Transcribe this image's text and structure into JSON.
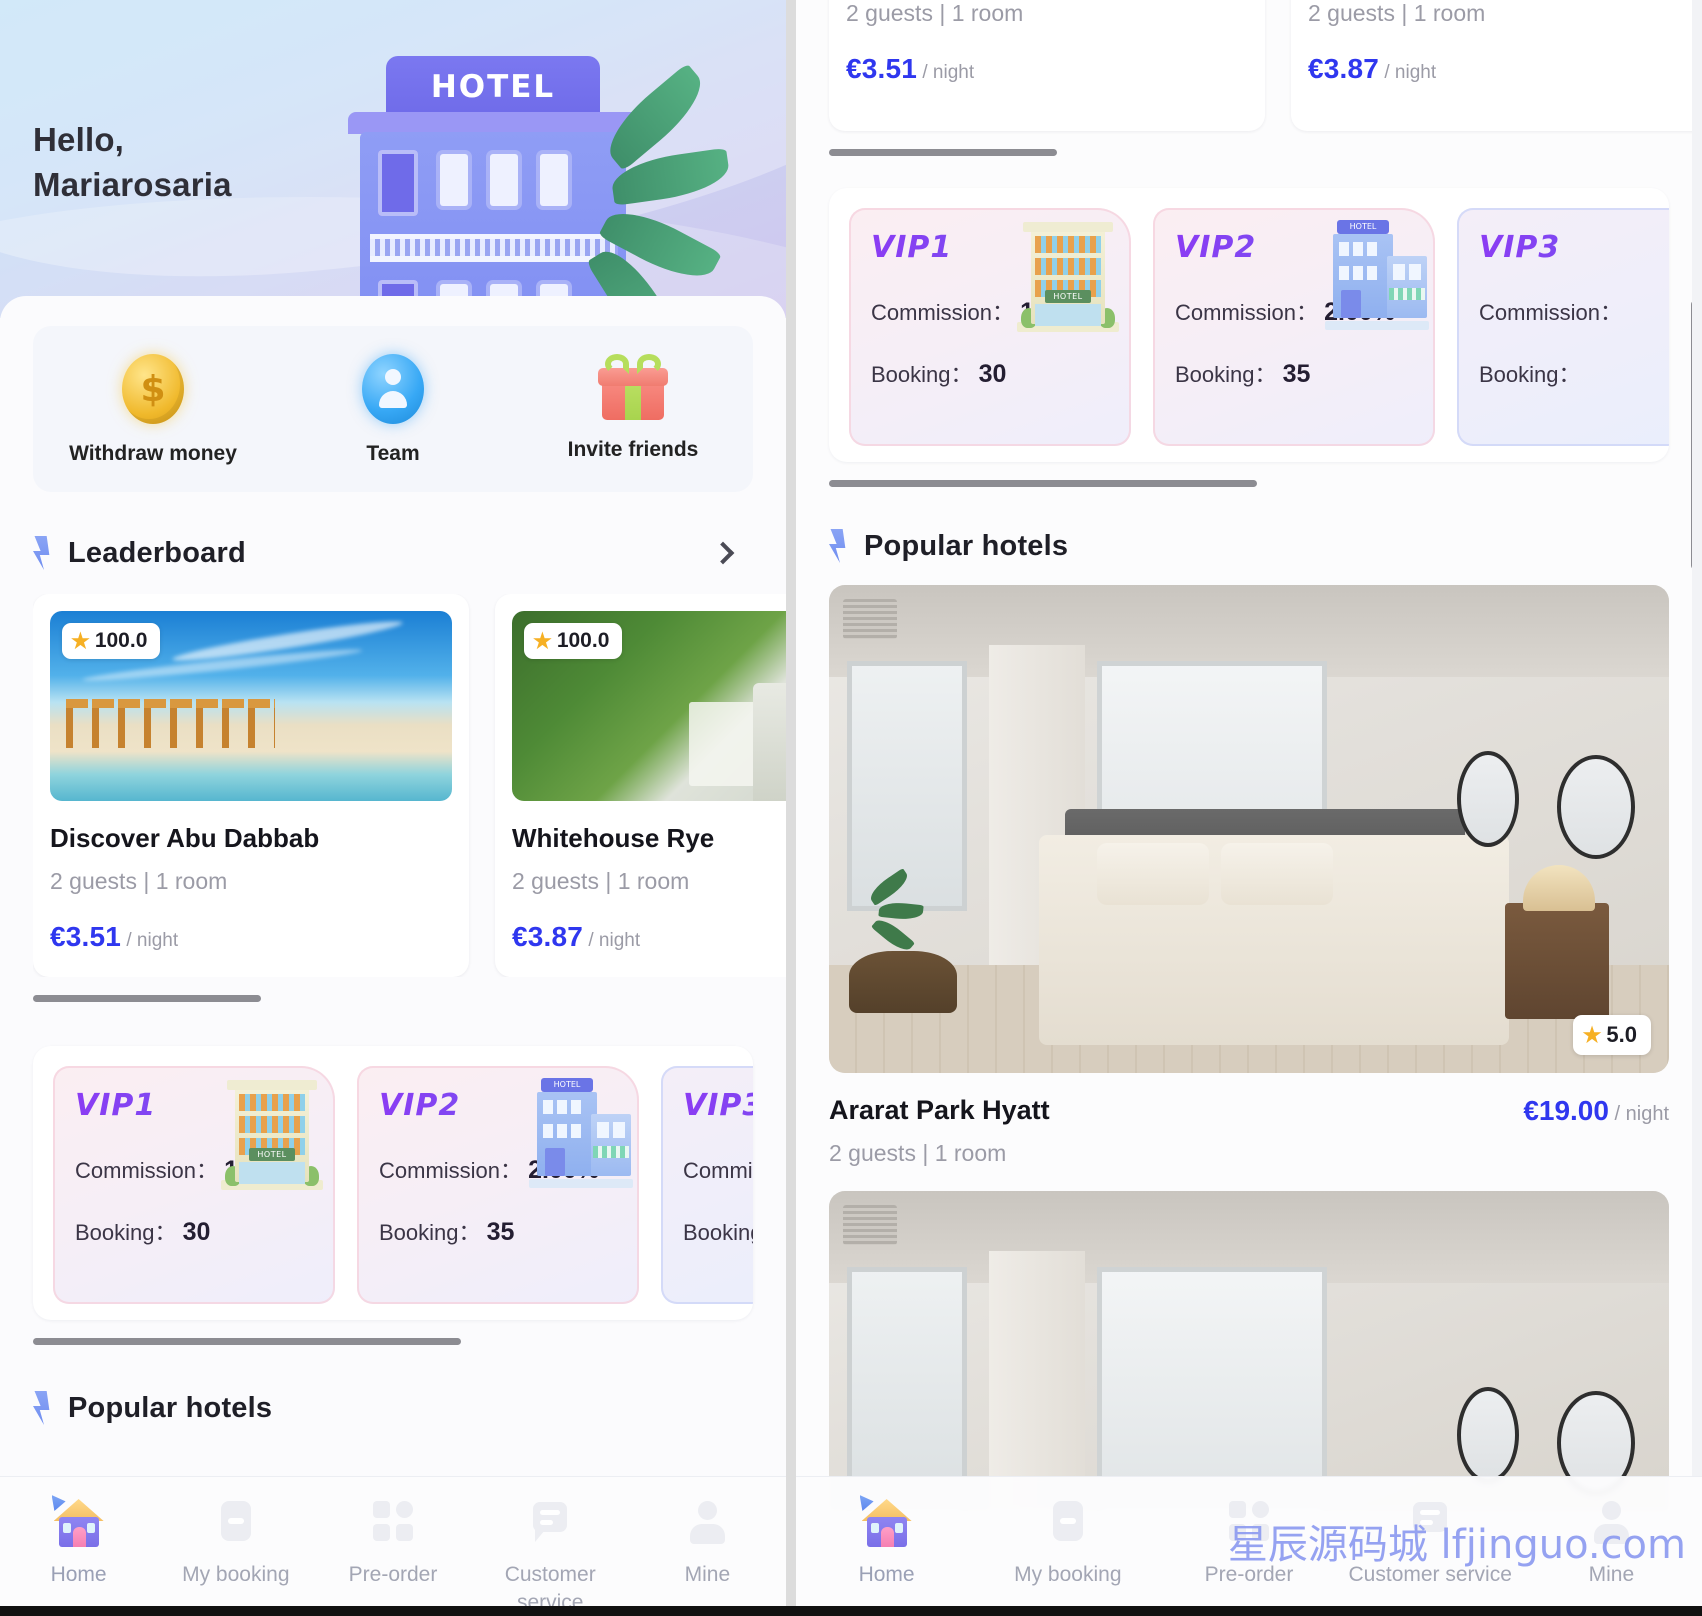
{
  "left_panel": {
    "hero": {
      "greeting_line1": "Hello,",
      "greeting_line2": "Mariarosaria",
      "hotel_sign": "HOTEL"
    },
    "quick_actions": [
      {
        "label": "Withdraw money",
        "icon": "coin-icon"
      },
      {
        "label": "Team",
        "icon": "team-icon"
      },
      {
        "label": "Invite friends",
        "icon": "gift-icon"
      }
    ],
    "leaderboard": {
      "title": "Leaderboard",
      "cards": [
        {
          "rating": "100.0",
          "name": "Discover Abu Dabbab",
          "meta": "2 guests | 1 room",
          "price": "€3.51",
          "price_unit": "/ night"
        },
        {
          "rating": "100.0",
          "name": "Whitehouse Rye",
          "meta": "2 guests | 1 room",
          "price": "€3.87",
          "price_unit": "/ night"
        }
      ]
    },
    "vip": {
      "label_commission": "Commission：",
      "label_booking": "Booking：",
      "cards": [
        {
          "tier": "VIP1",
          "commission": "1.00%",
          "booking": "30"
        },
        {
          "tier": "VIP2",
          "commission": "2.00%",
          "booking": "35"
        },
        {
          "tier": "VIP3",
          "commission": "",
          "booking": ""
        }
      ]
    },
    "popular_title": "Popular hotels"
  },
  "right_panel": {
    "leaderboard_cards": [
      {
        "meta": "2 guests | 1 room",
        "price": "€3.51",
        "price_unit": "/ night"
      },
      {
        "meta": "2 guests | 1 room",
        "price": "€3.87",
        "price_unit": "/ night"
      }
    ],
    "vip": {
      "label_commission": "Commission：",
      "label_booking": "Booking：",
      "cards": [
        {
          "tier": "VIP1",
          "commission": "1.00%",
          "booking": "30"
        },
        {
          "tier": "VIP2",
          "commission": "2.00%",
          "booking": "35"
        },
        {
          "tier": "VIP3",
          "commission": "",
          "booking": ""
        }
      ]
    },
    "popular": {
      "title": "Popular hotels",
      "hotel": {
        "rating": "5.0",
        "name": "Ararat Park Hyatt",
        "meta": "2 guests | 1 room",
        "price": "€19.00",
        "price_unit": "/ night"
      }
    }
  },
  "tabbar": {
    "items": [
      {
        "label": "Home",
        "icon": "home-icon",
        "active": true
      },
      {
        "label": "My\nbooking",
        "icon": "booking-icon",
        "active": false
      },
      {
        "label": "Pre-order",
        "icon": "grid-icon",
        "active": false
      },
      {
        "label": "Customer\nservice",
        "icon": "chat-icon",
        "active": false
      },
      {
        "label": "Mine",
        "icon": "user-icon",
        "active": false
      }
    ]
  },
  "watermark": "星辰源码城 lfjinguo.com",
  "colors": {
    "price_blue": "#2f37ef",
    "star_gold": "#f6b024",
    "vip_purple": "#8b3cf3",
    "muted_text": "#9b9ba6"
  }
}
